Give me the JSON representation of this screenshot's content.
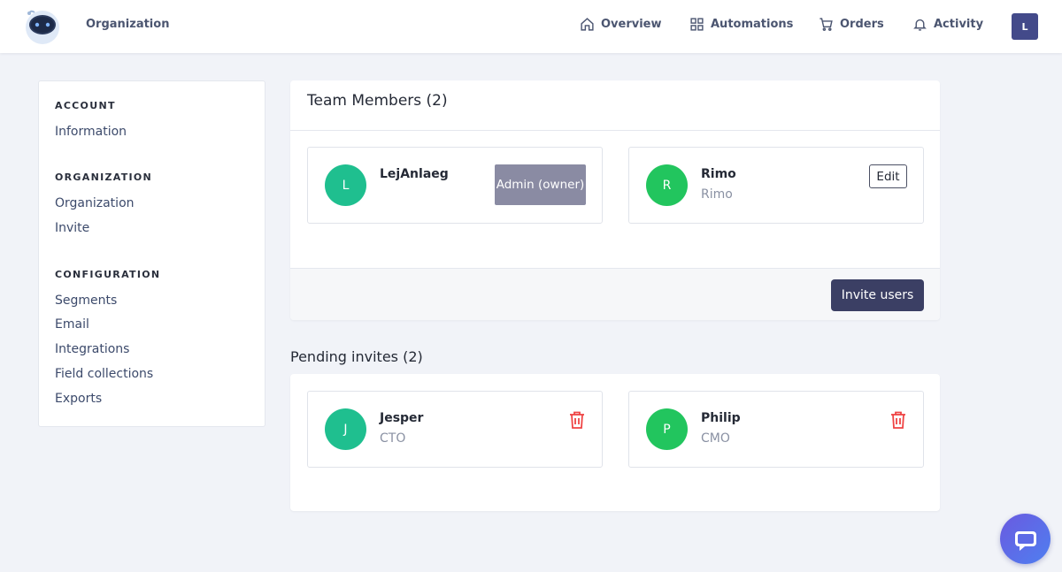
{
  "header": {
    "brand": "Organization",
    "nav": [
      {
        "label": "Overview",
        "icon": "home-icon"
      },
      {
        "label": "Automations",
        "icon": "grid-icon"
      },
      {
        "label": "Orders",
        "icon": "cart-icon"
      },
      {
        "label": "Activity",
        "icon": "bell-icon"
      }
    ],
    "user_initial": "L"
  },
  "sidebar": {
    "sections": [
      {
        "title": "ACCOUNT",
        "items": [
          "Information"
        ]
      },
      {
        "title": "ORGANIZATION",
        "items": [
          "Organization",
          "Invite"
        ]
      },
      {
        "title": "CONFIGURATION",
        "items": [
          "Segments",
          "Email",
          "Integrations",
          "Field collections",
          "Exports"
        ]
      }
    ]
  },
  "team": {
    "title": "Team Members (2)",
    "members": [
      {
        "initial": "L",
        "name": "LejAnlaeg",
        "subtitle": "",
        "badge": "Admin (owner)",
        "avatar_color": "#1fbf8f"
      },
      {
        "initial": "R",
        "name": "Rimo",
        "subtitle": "Rimo",
        "action": "Edit",
        "avatar_color": "#22c55e"
      }
    ],
    "invite_button": "Invite users"
  },
  "pending": {
    "title": "Pending invites (2)",
    "invites": [
      {
        "initial": "J",
        "name": "Jesper",
        "role": "CTO",
        "avatar_color": "#1fbf8f"
      },
      {
        "initial": "P",
        "name": "Philip",
        "role": "CMO",
        "avatar_color": "#22c55e"
      }
    ]
  },
  "colors": {
    "accent": "#3b3f64",
    "danger": "#ef4444",
    "badge": "#8a8ba3"
  }
}
